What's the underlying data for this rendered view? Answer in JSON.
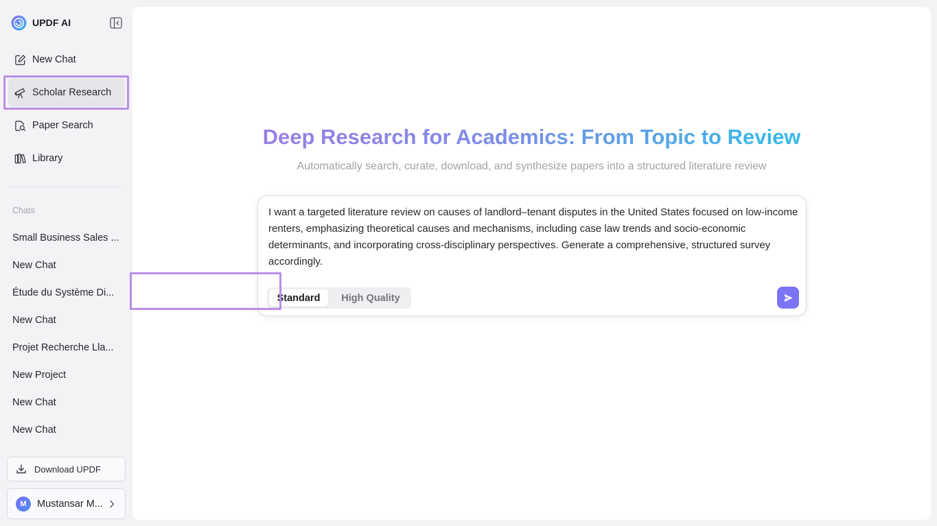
{
  "brand": {
    "name": "UPDF AI",
    "logo_icon": "updf-logo-icon"
  },
  "sidebar": {
    "collapse_icon": "sidebar-collapse-icon",
    "nav": [
      {
        "label": "New Chat",
        "icon": "edit-square-icon"
      },
      {
        "label": "Scholar Research",
        "icon": "telescope-icon",
        "selected": true
      },
      {
        "label": "Paper Search",
        "icon": "document-search-icon"
      },
      {
        "label": "Library",
        "icon": "books-icon"
      }
    ],
    "chats_heading": "Chats",
    "chats": [
      "Small Business Sales ...",
      "New Chat",
      "Étude du Système Di...",
      "New Chat",
      "Projet Recherche Lla...",
      "New Project",
      "New Chat",
      "New Chat"
    ],
    "download": {
      "label": "Download UPDF",
      "icon": "download-icon"
    },
    "user": {
      "initial": "M",
      "name": "Mustansar M...",
      "chevron_icon": "chevron-right-icon"
    }
  },
  "main": {
    "title": "Deep Research for Academics: From Topic to Review",
    "subtitle": "Automatically search, curate, download, and synthesize papers into a structured literature review",
    "prompt": "I want a targeted literature review on causes of landlord–tenant disputes in the United States focused on low-income renters, emphasizing theoretical causes and mechanisms, including case law trends and socio-economic determinants, and incorporating cross-disciplinary perspectives. Generate a comprehensive, structured survey accordingly.",
    "modes": {
      "standard": "Standard",
      "high_quality": "High Quality",
      "selected": "Standard"
    },
    "send_icon": "send-icon"
  },
  "colors": {
    "accent": "#7b74f5",
    "highlight_border": "#b98ee8",
    "title_gradient_start": "#9a7ee6",
    "title_gradient_end": "#34bbe8",
    "selected_nav_bg": "#e6e6ea"
  }
}
